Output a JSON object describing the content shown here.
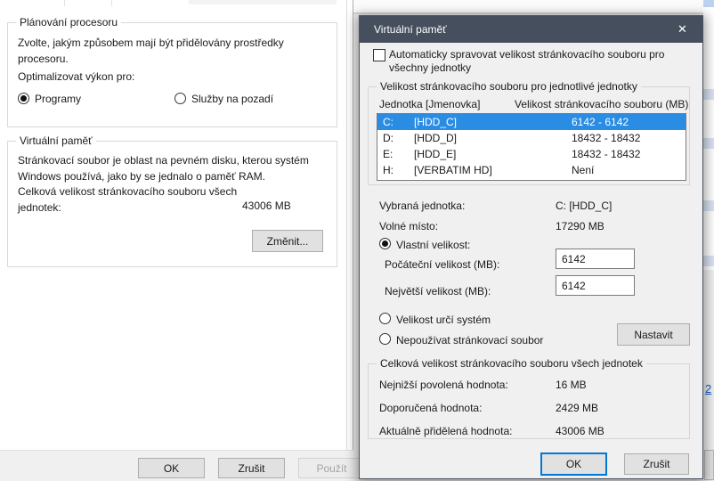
{
  "colors": {
    "titlebar": "#454f5e",
    "selection_blue": "#2a8ce2",
    "focus_blue": "#0078d7",
    "link_blue": "#0c5fcd",
    "dialog_gray": "#f0f0f0"
  },
  "left_dialog": {
    "processor_group": {
      "title": "Plánování procesoru",
      "description": "Zvolte, jakým způsobem mají být přidělovány prostředky procesoru.",
      "optimize_label": "Optimalizovat výkon pro:",
      "radio_programs_label": "Programy",
      "radio_services_label": "Služby na pozadí"
    },
    "memory_group": {
      "title": "Virtuální paměť",
      "description": "Stránkovací soubor je oblast na pevném disku, kterou systém Windows používá, jako by se jednalo o paměť RAM.",
      "total_label": "Celková velikost stránkovacího souboru všech jednotek:",
      "total_value": "43006 MB",
      "change_button_label": "Změnit..."
    },
    "footer": {
      "ok_label": "OK",
      "cancel_label": "Zrušit",
      "apply_label": "Použít"
    }
  },
  "vm_dialog": {
    "title": "Virtuální paměť",
    "close_glyph": "✕",
    "auto_checkbox_label": "Automaticky spravovat velikost stránkovacího souboru pro všechny jednotky",
    "per_drive_group": {
      "title": "Velikost stránkovacího souboru pro jednotlivé jednotky",
      "columns": {
        "drive": "Jednotka [Jmenovka]",
        "size": "Velikost stránkovacího souboru (MB)"
      },
      "rows": [
        {
          "drive": "C:",
          "volume": "[HDD_C]",
          "size": "6142 - 6142"
        },
        {
          "drive": "D:",
          "volume": "[HDD_D]",
          "size": "18432 - 18432"
        },
        {
          "drive": "E:",
          "volume": "[HDD_E]",
          "size": "18432 - 18432"
        },
        {
          "drive": "H:",
          "volume": "[VERBATIM HD]",
          "size": "Není"
        }
      ],
      "selected_label": "Vybraná jednotka:",
      "selected_value": "C:  [HDD_C]",
      "free_label": "Volné místo:",
      "free_value": "17290 MB",
      "custom_radio_label": "Vlastní velikost:",
      "initial_label": "Počáteční velikost (MB):",
      "initial_value": "6142",
      "maximum_label": "Největší velikost (MB):",
      "maximum_value": "6142",
      "system_radio_label": "Velikost určí systém",
      "no_paging_radio_label": "Nepoužívat stránkovací soubor",
      "set_button_label": "Nastavit"
    },
    "totals_group": {
      "title": "Celková velikost stránkovacího souboru všech jednotek",
      "rows": [
        {
          "label": "Nejnižší povolená hodnota:",
          "value": "16 MB"
        },
        {
          "label": "Doporučená hodnota:",
          "value": "2429 MB"
        },
        {
          "label": "Aktuálně přidělená hodnota:",
          "value": "43006 MB"
        }
      ]
    },
    "footer": {
      "ok_label": "OK",
      "cancel_label": "Zrušit"
    }
  },
  "background_window": {
    "link_text": "2"
  }
}
